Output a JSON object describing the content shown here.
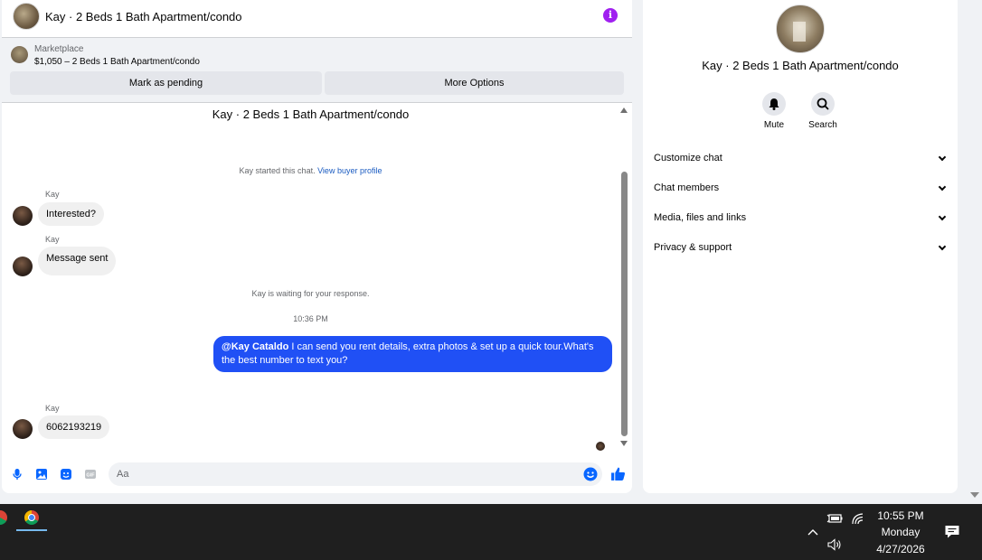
{
  "chat": {
    "header_title": "Kay · 2 Beds 1 Bath Apartment/condo",
    "marketplace_label": "Marketplace",
    "listing_price_title": "$1,050 – 2 Beds 1 Bath Apartment/condo",
    "mark_pending_label": "Mark as pending",
    "more_options_label": "More Options",
    "conversation_title": "Kay · 2 Beds 1 Bath Apartment/condo",
    "started_text": "Kay started this chat.",
    "buyer_profile_link": "View buyer profile",
    "waiting_text": "Kay is waiting for your response.",
    "timestamp": "10:36 PM",
    "messages": [
      {
        "sender": "Kay",
        "text": "Interested?"
      },
      {
        "sender": "Kay",
        "text": "Message sent"
      },
      {
        "sender": "Kay",
        "text": "6062193219"
      }
    ],
    "outgoing": {
      "mention": "@Kay Cataldo",
      "text": " I can send you rent details, extra photos & set up a quick tour.What's the best number to text you?"
    },
    "composer_placeholder": "Aa"
  },
  "info_panel": {
    "title": "Kay · 2 Beds 1 Bath Apartment/condo",
    "mute_label": "Mute",
    "search_label": "Search",
    "sections": [
      "Customize chat",
      "Chat members",
      "Media, files and links",
      "Privacy & support"
    ]
  },
  "taskbar": {
    "time": "10:55 PM",
    "day": "Monday",
    "date": "4/27/2026"
  },
  "colors": {
    "accent_blue": "#2050f5",
    "info_purple": "#a020f0",
    "link_blue": "#1a5bc1"
  }
}
